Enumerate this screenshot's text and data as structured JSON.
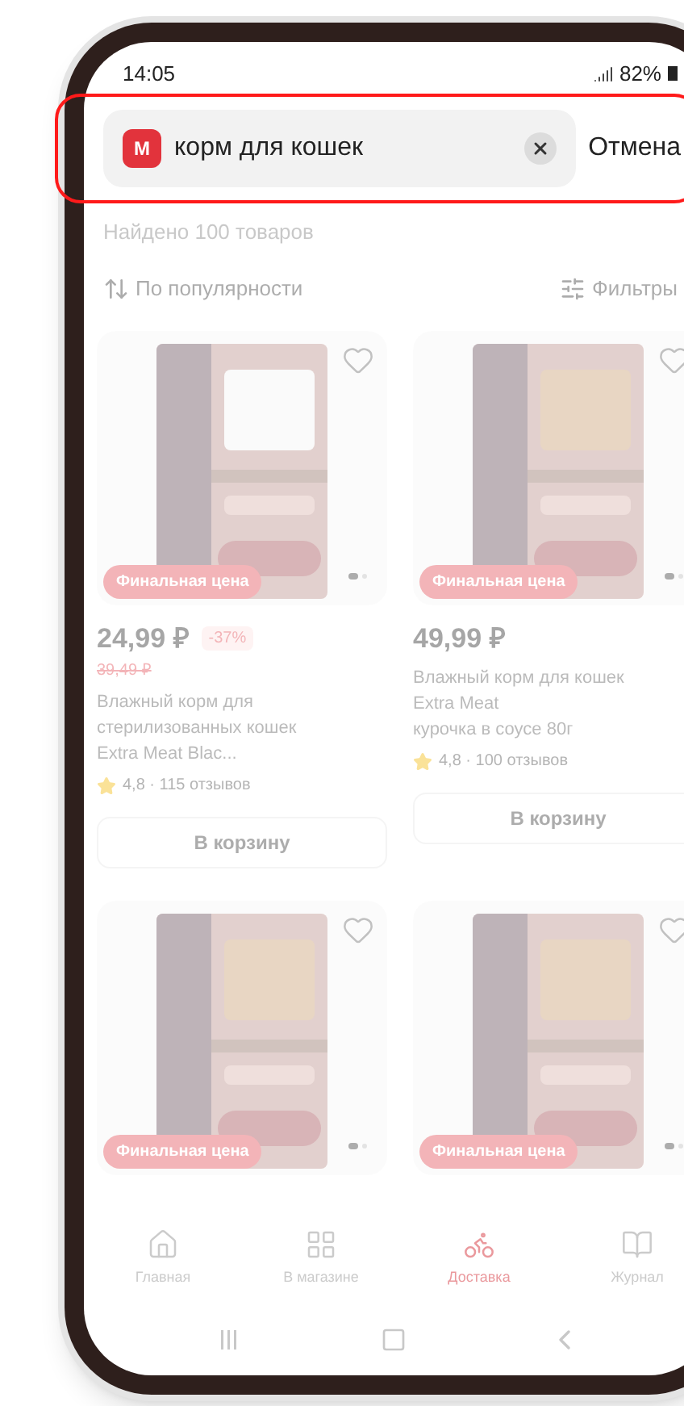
{
  "status_bar": {
    "time": "14:05",
    "battery": "82%"
  },
  "search": {
    "logo": "M",
    "value": "корм для кошек",
    "cancel": "Отмена"
  },
  "results_count": "Найдено 100 товаров",
  "sort": {
    "label": "По популярности"
  },
  "filters": {
    "label": "Фильтры"
  },
  "products": [
    {
      "badge": "Финальная цена",
      "price": "24,99 ₽",
      "discount": "-37%",
      "old_price": "39,49 ₽",
      "title_lines": [
        "Влажный корм для",
        "стерилизованных кошек",
        "Extra Meat Blac..."
      ],
      "rating": "4,8 · 115 отзывов",
      "button": "В корзину"
    },
    {
      "badge": "Финальная цена",
      "price": "49,99 ₽",
      "title_lines": [
        "Влажный корм для кошек",
        "Extra Meat",
        "курочка в соусе 80г"
      ],
      "rating": "4,8 · 100 отзывов",
      "button": "В корзину"
    },
    {
      "badge": "Финальная цена"
    },
    {
      "badge": "Финальная цена"
    }
  ],
  "bottom_nav": [
    {
      "kind": "home",
      "label": "Главная",
      "selected": false
    },
    {
      "kind": "grid",
      "label": "В магазине",
      "selected": false
    },
    {
      "kind": "delivery",
      "label": "Доставка",
      "selected": true
    },
    {
      "kind": "journal",
      "label": "Журнал",
      "selected": false
    }
  ]
}
